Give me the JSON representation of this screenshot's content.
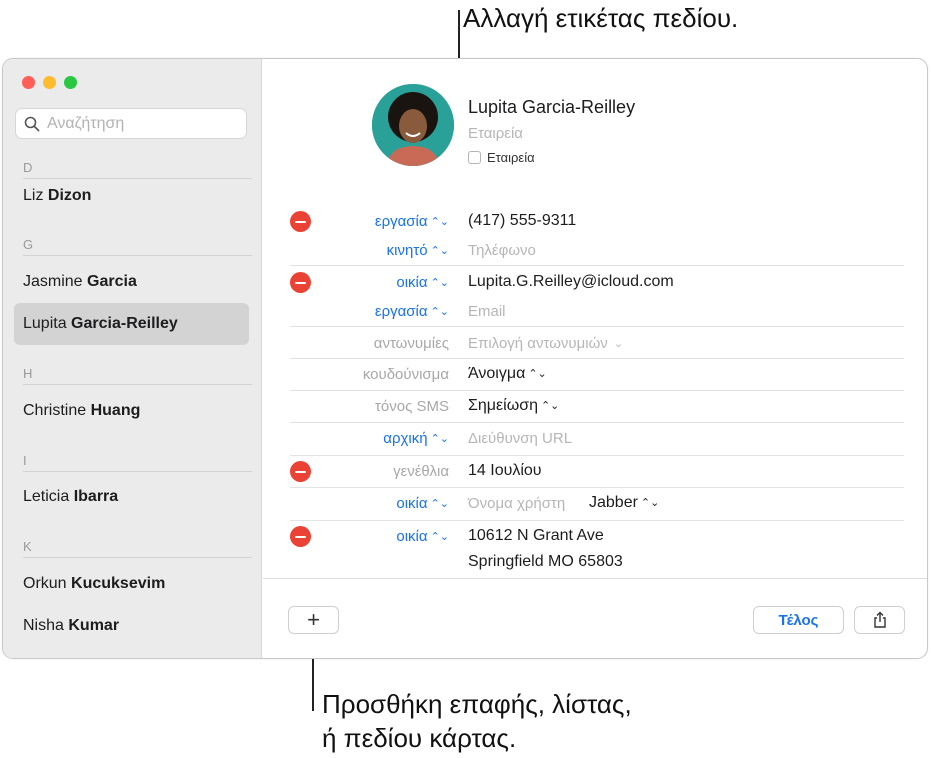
{
  "callouts": {
    "top": "Αλλαγή ετικέτας πεδίου.",
    "bottom_line1": "Προσθήκη επαφής, λίστας,",
    "bottom_line2": "ή πεδίου κάρτας."
  },
  "colors": {
    "accent": "#1a73e8",
    "delete": "#ea4335",
    "traffic_red": "#ff5f57",
    "traffic_yellow": "#febc2e",
    "traffic_green": "#28c840"
  },
  "sidebar": {
    "search_placeholder": "Αναζήτηση",
    "sections": [
      {
        "letter": "D",
        "contacts": [
          {
            "first": "Liz",
            "last": "Dizon"
          }
        ]
      },
      {
        "letter": "G",
        "contacts": [
          {
            "first": "Jasmine",
            "last": "Garcia"
          },
          {
            "first": "Lupita",
            "last": "Garcia-Reilley",
            "selected": true
          }
        ]
      },
      {
        "letter": "H",
        "contacts": [
          {
            "first": "Christine",
            "last": "Huang"
          }
        ]
      },
      {
        "letter": "I",
        "contacts": [
          {
            "first": "Leticia",
            "last": "Ibarra"
          }
        ]
      },
      {
        "letter": "K",
        "contacts": [
          {
            "first": "Orkun",
            "last": "Kucuksevim"
          },
          {
            "first": "Nisha",
            "last": "Kumar"
          }
        ]
      }
    ]
  },
  "card": {
    "name": "Lupita  Garcia-Reilley",
    "company_placeholder": "Εταιρεία",
    "company_checkbox_label": "Εταιρεία",
    "fields": [
      {
        "label": "εργασία",
        "value": "(417) 555-9311"
      },
      {
        "label": "κινητό",
        "placeholder": "Τηλέφωνο"
      },
      {
        "label": "οικία",
        "value": "Lupita.G.Reilley@icloud.com"
      },
      {
        "label": "εργασία",
        "placeholder": "Email"
      },
      {
        "label": "αντωνυμίες",
        "placeholder": "Επιλογή αντωνυμιών"
      },
      {
        "label": "κουδούνισμα",
        "value": "Άνοιγμα"
      },
      {
        "label": "τόνος SMS",
        "value": "Σημείωση"
      },
      {
        "label": "αρχική",
        "placeholder": "Διεύθυνση URL"
      },
      {
        "label": "γενέθλια",
        "value": "14 Ιουλίου"
      },
      {
        "label": "οικία",
        "placeholder": "Όνομα χρήστη",
        "value": "Jabber"
      },
      {
        "label": "οικία",
        "value_line1": "10612 N Grant Ave",
        "value_line2": "Springfield MO 65803"
      }
    ]
  },
  "toolbar": {
    "add_label": "+",
    "done_label": "Τέλος"
  }
}
